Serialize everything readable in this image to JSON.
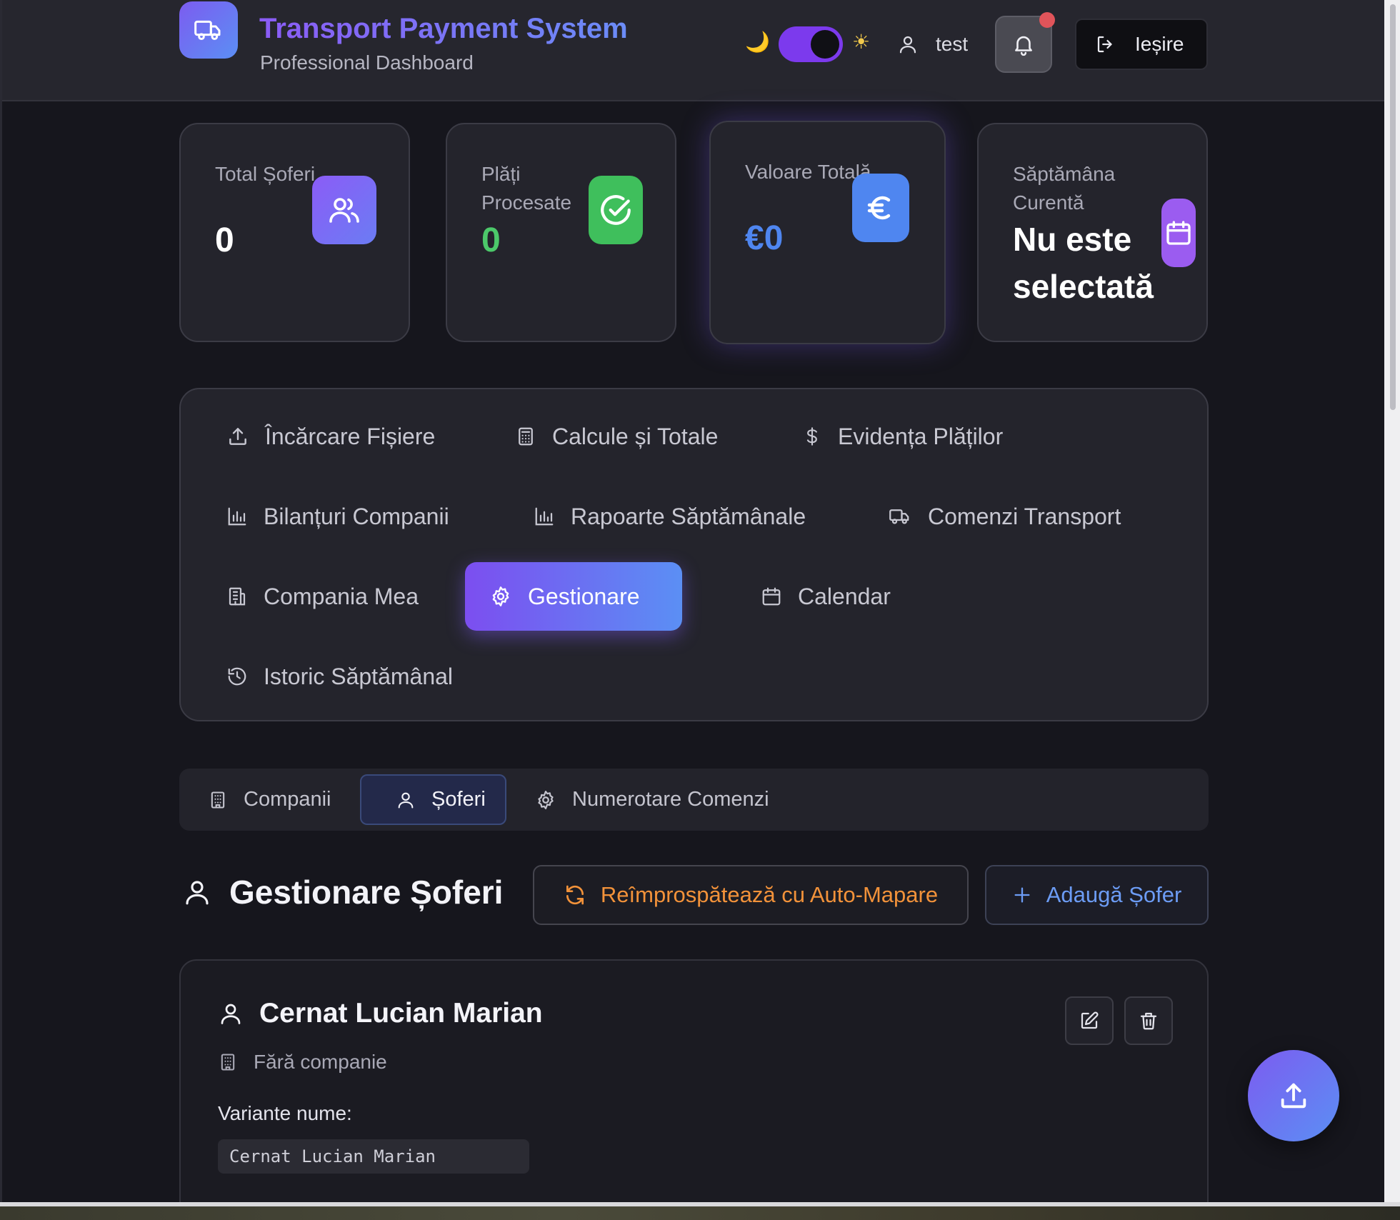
{
  "header": {
    "title": "Transport Payment System",
    "subtitle": "Professional Dashboard",
    "theme_moon": "🌙",
    "theme_sun": "☀",
    "username": "test",
    "logout_label": "Ieșire",
    "notification_dot": true
  },
  "stats": [
    {
      "label": "Total Șoferi",
      "value": "0",
      "icon": "users-icon",
      "value_color": "#ffffff",
      "icon_color": "#7c5cf0"
    },
    {
      "label": "Plăți Procesate",
      "value": "0",
      "icon": "check-circle-icon",
      "value_color": "#4cc96a",
      "icon_color": "#3fbf5c"
    },
    {
      "label": "Valoare Totală",
      "value": "€0",
      "icon": "euro-icon",
      "value_color": "#4f86f0",
      "icon_color": "#4f86f0"
    },
    {
      "label": "Săptămâna Curentă",
      "value": "Nu este selectată",
      "icon": "calendar-icon",
      "value_color": "#ffffff",
      "icon_color": "#9b5cf0"
    }
  ],
  "nav": {
    "items": [
      {
        "label": "Încărcare Fișiere",
        "icon": "upload-icon"
      },
      {
        "label": "Calcule și Totale",
        "icon": "calculator-icon"
      },
      {
        "label": "Evidența Plăților",
        "icon": "dollar-icon"
      },
      {
        "label": "Bilanțuri Companii",
        "icon": "bar-chart-icon"
      },
      {
        "label": "Rapoarte Săptămânale",
        "icon": "bar-chart-icon"
      },
      {
        "label": "Comenzi Transport",
        "icon": "truck-icon"
      },
      {
        "label": "Compania Mea",
        "icon": "building-icon"
      },
      {
        "label": "Gestionare",
        "icon": "gear-icon",
        "active": true
      },
      {
        "label": "Calendar",
        "icon": "calendar-icon"
      },
      {
        "label": "Istoric Săptămânal",
        "icon": "history-icon"
      }
    ]
  },
  "tabs": [
    {
      "label": "Companii",
      "icon": "building-icon"
    },
    {
      "label": "Șoferi",
      "icon": "user-icon",
      "active": true
    },
    {
      "label": "Numerotare Comenzi",
      "icon": "gear-icon"
    }
  ],
  "section": {
    "title": "Gestionare Șoferi",
    "refresh_label": "Reîmprospătează cu Auto-Mapare",
    "add_label": "Adaugă Șofer"
  },
  "driver": {
    "name": "Cernat Lucian Marian",
    "company": "Fără companie",
    "variants_label": "Variante nume:",
    "variants": [
      "Cernat Lucian Marian"
    ]
  },
  "colors": {
    "accent_start": "#7c4ef0",
    "accent_end": "#5b8ff4",
    "refresh": "#f2923a",
    "add": "#6c9cf5"
  }
}
